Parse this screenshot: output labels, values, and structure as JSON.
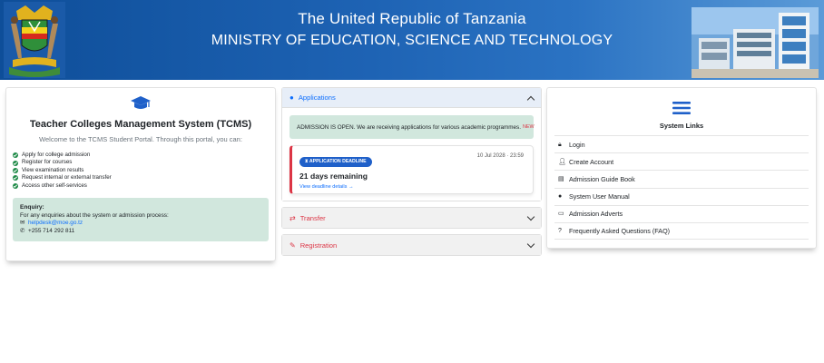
{
  "header": {
    "line1": "The United Republic of Tanzania",
    "line2": "MINISTRY OF EDUCATION, SCIENCE AND TECHNOLOGY",
    "left_image": "coat-of-arms",
    "right_image": "ministry-building"
  },
  "left_card": {
    "icon": "graduation-cap-icon",
    "title": "Teacher Colleges Management System (TCMS)",
    "welcome": "Welcome to the TCMS Student Portal. Through this portal, you can:",
    "features": [
      "Apply for college admission",
      "Register for courses",
      "View examination results",
      "Request internal or external transfer",
      "Access other self-services"
    ],
    "enquiry": {
      "title": "Enquiry:",
      "text": "For any enquiries about the system or admission process:",
      "email": "helpdesk@moe.go.tz",
      "phone": "+255 714 292 811"
    }
  },
  "accordion": {
    "applications_label": "Applications",
    "open_notice": "ADMISSION IS OPEN. We are receiving applications for various academic programmes.",
    "new_badge": "NEW",
    "deadline_pill": "APPLICATION DEADLINE",
    "deadline_date": "10 Jul 2028 · 23:59",
    "days_remaining": "21 days remaining",
    "deadline_link": "View deadline details →",
    "transfer_label": "Transfer",
    "registration_label": "Registration"
  },
  "system_links": {
    "title": "System Links",
    "items": [
      {
        "label": "Login",
        "icon": "lock-icon"
      },
      {
        "label": "Create Account",
        "icon": "user-plus-icon"
      },
      {
        "label": "Admission Guide Book",
        "icon": "book-icon"
      },
      {
        "label": "System User Manual",
        "icon": "info-icon"
      },
      {
        "label": "Admission Adverts",
        "icon": "laptop-icon"
      },
      {
        "label": "Frequently Asked Questions (FAQ)",
        "icon": "question-icon"
      }
    ]
  },
  "colors": {
    "header_blue": "#1e63b4",
    "success_green": "#1e8a47",
    "alert_green_bg": "#d1e7dd",
    "link_blue": "#0d6efd",
    "danger_red": "#dc3545"
  }
}
